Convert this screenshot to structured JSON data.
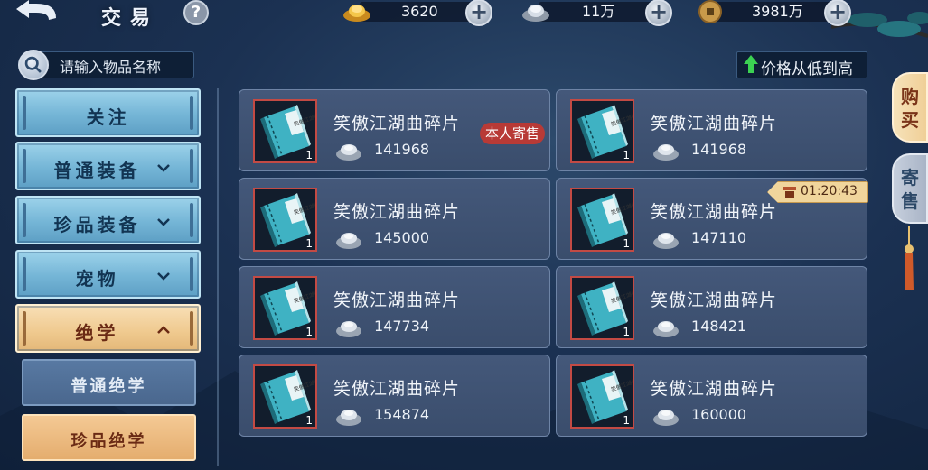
{
  "header": {
    "title": "交易",
    "help_label": "?",
    "currencies": [
      {
        "icon": "gold-ingot-icon",
        "value": "3620"
      },
      {
        "icon": "silver-ingot-icon",
        "value": "11万"
      },
      {
        "icon": "copper-coin-icon",
        "value": "3981万"
      }
    ]
  },
  "search": {
    "placeholder": "请输入物品名称"
  },
  "sort": {
    "label": "价格从低到高"
  },
  "categories": [
    {
      "label": "关注"
    },
    {
      "label": "普通装备"
    },
    {
      "label": "珍品装备"
    },
    {
      "label": "宠物"
    },
    {
      "label": "绝学"
    }
  ],
  "subcategories": [
    {
      "label": "普通绝学"
    },
    {
      "label": "珍品绝学"
    }
  ],
  "items": [
    {
      "name": "笑傲江湖曲碎片",
      "price": "141968",
      "qty": "1",
      "tag": "本人寄售"
    },
    {
      "name": "笑傲江湖曲碎片",
      "price": "141968",
      "qty": "1"
    },
    {
      "name": "笑傲江湖曲碎片",
      "price": "145000",
      "qty": "1"
    },
    {
      "name": "笑傲江湖曲碎片",
      "price": "147110",
      "qty": "1",
      "timer": "01:20:43"
    },
    {
      "name": "笑傲江湖曲碎片",
      "price": "147734",
      "qty": "1"
    },
    {
      "name": "笑傲江湖曲碎片",
      "price": "148421",
      "qty": "1"
    },
    {
      "name": "笑傲江湖曲碎片",
      "price": "154874",
      "qty": "1"
    },
    {
      "name": "笑傲江湖曲碎片",
      "price": "160000",
      "qty": "1"
    }
  ],
  "side_tabs": [
    {
      "label": "购买"
    },
    {
      "label": "寄售"
    }
  ],
  "book_title": "笑傲江湖曲",
  "colors": {
    "accent": "#efc98e",
    "card": "#3a4d6c",
    "tag": "#b83a36"
  }
}
